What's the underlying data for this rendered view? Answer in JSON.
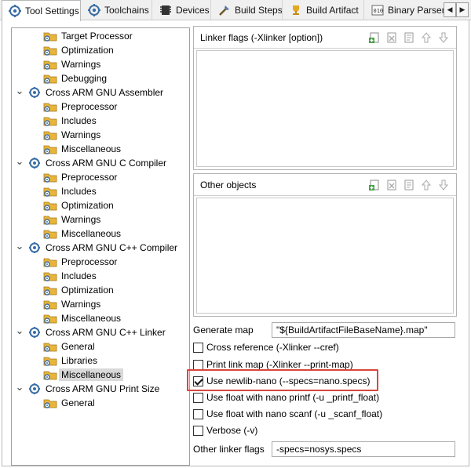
{
  "tabs": [
    {
      "label": "Tool Settings",
      "icon": "gear-icon",
      "active": true
    },
    {
      "label": "Toolchains",
      "icon": "gear-icon"
    },
    {
      "label": "Devices",
      "icon": "chip-icon"
    },
    {
      "label": "Build Steps",
      "icon": "build-steps-icon"
    },
    {
      "label": "Build Artifact",
      "icon": "trophy-icon"
    },
    {
      "label": "Binary Parsers",
      "icon": "binary-icon"
    }
  ],
  "tree": [
    {
      "label": "Target Processor",
      "kind": "folder"
    },
    {
      "label": "Optimization",
      "kind": "folder"
    },
    {
      "label": "Warnings",
      "kind": "folder"
    },
    {
      "label": "Debugging",
      "kind": "folder"
    },
    {
      "label": "Cross ARM GNU Assembler",
      "kind": "tool",
      "expanded": true
    },
    {
      "label": "Preprocessor",
      "kind": "folder"
    },
    {
      "label": "Includes",
      "kind": "folder"
    },
    {
      "label": "Warnings",
      "kind": "folder"
    },
    {
      "label": "Miscellaneous",
      "kind": "folder"
    },
    {
      "label": "Cross ARM GNU C Compiler",
      "kind": "tool",
      "expanded": true
    },
    {
      "label": "Preprocessor",
      "kind": "folder"
    },
    {
      "label": "Includes",
      "kind": "folder"
    },
    {
      "label": "Optimization",
      "kind": "folder"
    },
    {
      "label": "Warnings",
      "kind": "folder"
    },
    {
      "label": "Miscellaneous",
      "kind": "folder"
    },
    {
      "label": "Cross ARM GNU C++ Compiler",
      "kind": "tool",
      "expanded": true
    },
    {
      "label": "Preprocessor",
      "kind": "folder"
    },
    {
      "label": "Includes",
      "kind": "folder"
    },
    {
      "label": "Optimization",
      "kind": "folder"
    },
    {
      "label": "Warnings",
      "kind": "folder"
    },
    {
      "label": "Miscellaneous",
      "kind": "folder"
    },
    {
      "label": "Cross ARM GNU C++ Linker",
      "kind": "tool",
      "expanded": true
    },
    {
      "label": "General",
      "kind": "folder"
    },
    {
      "label": "Libraries",
      "kind": "folder"
    },
    {
      "label": "Miscellaneous",
      "kind": "folder",
      "selected": true
    },
    {
      "label": "Cross ARM GNU Print Size",
      "kind": "tool",
      "expanded": true
    },
    {
      "label": "General",
      "kind": "folder"
    }
  ],
  "linker_flags": {
    "title": "Linker flags (-Xlinker [option])"
  },
  "other_objects": {
    "title": "Other objects"
  },
  "generate_map": {
    "label": "Generate map",
    "value": "\"${BuildArtifactFileBaseName}.map\""
  },
  "options": [
    {
      "label": "Cross reference (-Xlinker --cref)",
      "checked": false
    },
    {
      "label": "Print link map (-Xlinker --print-map)",
      "checked": false
    },
    {
      "label": "Use newlib-nano (--specs=nano.specs)",
      "checked": true
    },
    {
      "label": "Use float with nano printf (-u _printf_float)",
      "checked": false
    },
    {
      "label": "Use float with nano scanf (-u _scanf_float)",
      "checked": false
    },
    {
      "label": "Verbose (-v)",
      "checked": false
    }
  ],
  "other_linker_flags": {
    "label": "Other linker flags",
    "value": "-specs=nosys.specs"
  },
  "tool_icons": [
    "add-icon",
    "delete-icon",
    "edit-icon",
    "move-up-icon",
    "move-down-icon"
  ],
  "colors": {
    "highlight": "#d9473e",
    "selection": "#d9d9d9",
    "folder": "#e8b53a"
  }
}
